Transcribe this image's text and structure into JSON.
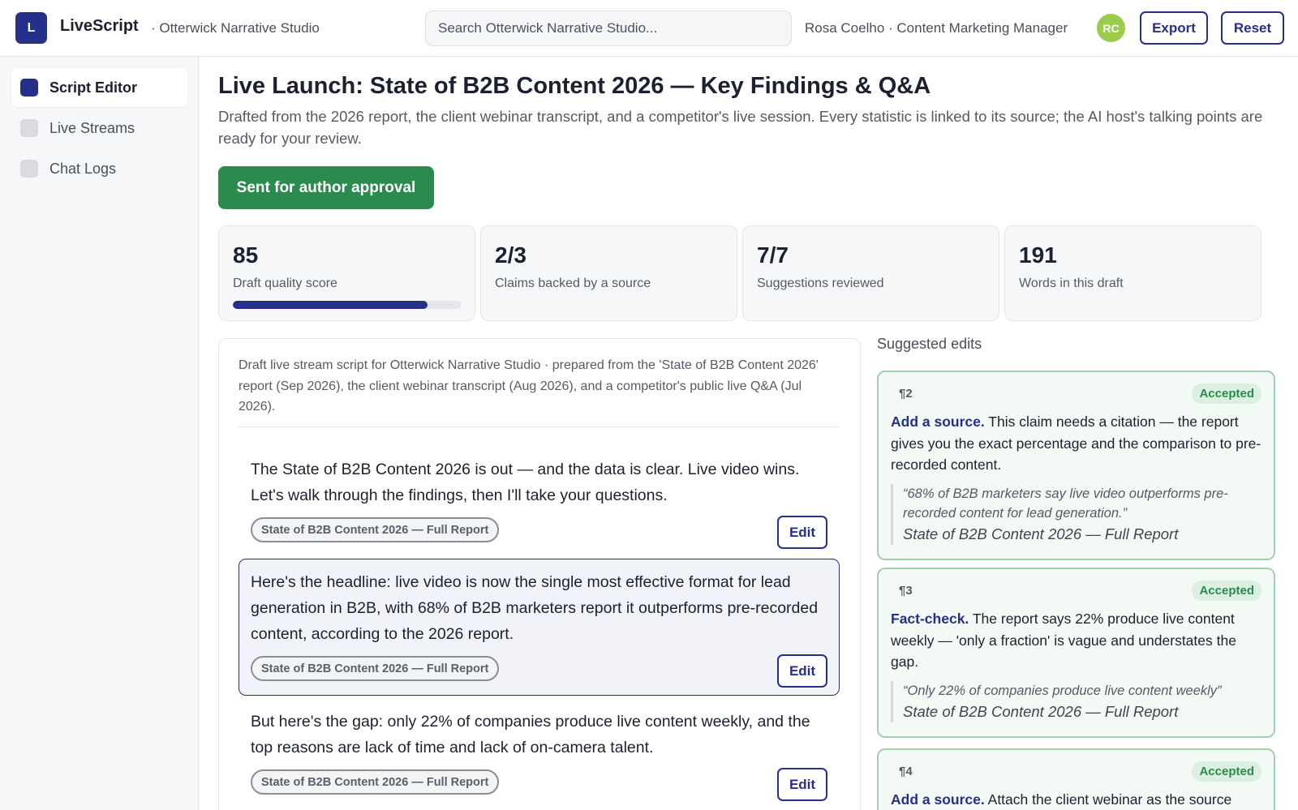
{
  "header": {
    "logo_letter": "L",
    "app_name": "LiveScript",
    "workspace": "· Otterwick Narrative Studio",
    "search_placeholder": "Search Otterwick Narrative Studio...",
    "user_label": "Rosa Coelho · Content Marketing Manager",
    "avatar_initials": "RC",
    "export_label": "Export",
    "reset_label": "Reset"
  },
  "sidebar": {
    "items": [
      {
        "label": "Script Editor",
        "active": true
      },
      {
        "label": "Live Streams",
        "active": false
      },
      {
        "label": "Chat Logs",
        "active": false
      }
    ]
  },
  "main": {
    "title": "Live Launch: State of B2B Content 2026 — Key Findings & Q&A",
    "subtitle": "Drafted from the 2026 report, the client webinar transcript, and a competitor's live session. Every statistic is linked to its source; the AI host's talking points are ready for your review.",
    "approve_label": "Sent for author approval",
    "stats": [
      {
        "value": "85",
        "label": "Draft quality score",
        "progress": 0.85
      },
      {
        "value": "2/3",
        "label": "Claims backed by a source"
      },
      {
        "value": "7/7",
        "label": "Suggestions reviewed"
      },
      {
        "value": "191",
        "label": "Words in this draft"
      }
    ]
  },
  "script": {
    "note": "Draft live stream script for Otterwick Narrative Studio · prepared from the 'State of B2B Content 2026' report (Sep 2026), the client webinar transcript (Aug 2026), and a competitor's public live Q&A (Jul 2026).",
    "edit_label": "Edit",
    "paragraphs": [
      {
        "text": "The State of B2B Content 2026 is out — and the data is clear. Live video wins. Let's walk through the findings, then I'll take your questions.",
        "source": "State of B2B Content 2026 — Full Report",
        "highlighted": false
      },
      {
        "text": "Here's the headline: live video is now the single most effective format for lead generation in B2B, with 68% of B2B marketers report it outperforms pre-recorded content, according to the 2026 report.",
        "source": "State of B2B Content 2026 — Full Report",
        "highlighted": true
      },
      {
        "text": "But here's the gap: only 22% of companies produce live content weekly, and the top reasons are lack of time and lack of on-camera talent.",
        "source": "State of B2B Content 2026 — Full Report",
        "highlighted": false
      }
    ]
  },
  "suggestions": {
    "title": "Suggested edits",
    "items": [
      {
        "para": "¶2",
        "status": "Accepted",
        "type": "Add a source.",
        "body": "This claim needs a citation — the report gives you the exact percentage and the comparison to pre-recorded content.",
        "quote": "“68% of B2B marketers say live video outperforms pre-recorded content for lead generation.”",
        "quote_source": "State of B2B Content 2026 — Full Report"
      },
      {
        "para": "¶3",
        "status": "Accepted",
        "type": "Fact-check.",
        "body": "The report says 22% produce live content weekly — 'only a fraction' is vague and understates the gap.",
        "quote": "“Only 22% of companies produce live content weekly”",
        "quote_source": "State of B2B Content 2026 — Full Report"
      },
      {
        "para": "¶4",
        "status": "Accepted",
        "type": "Add a source.",
        "body": "Attach the client webinar as the source"
      }
    ]
  },
  "colors": {
    "brand": "#262f8a",
    "approve": "#2b8a4e",
    "accepted_border": "#9fd0b0",
    "avatar": "#9ccc4e"
  }
}
